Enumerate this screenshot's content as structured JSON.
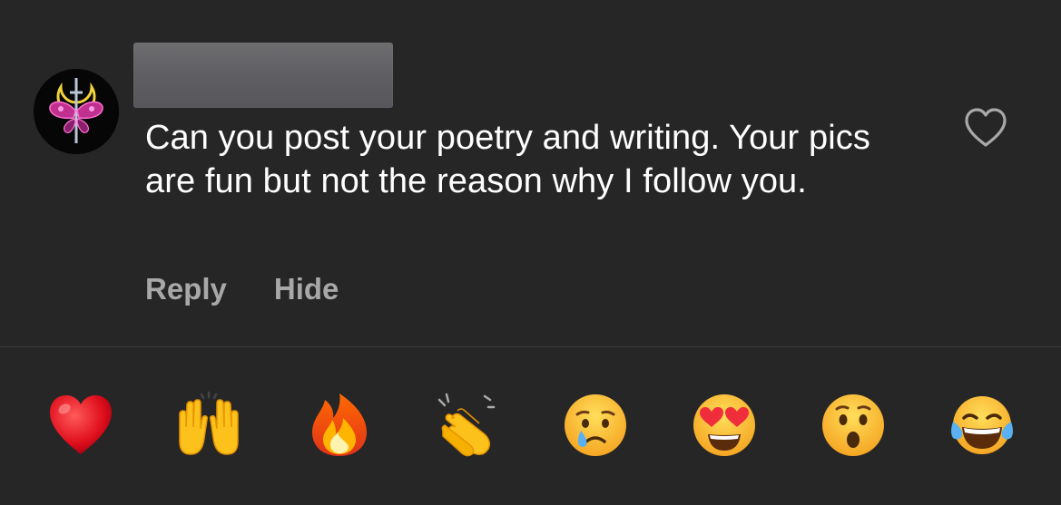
{
  "comment": {
    "username": "",
    "text": "Can you post your poetry and writing. Your pics are fun but not the reason why I follow you.",
    "actions": {
      "reply_label": "Reply",
      "hide_label": "Hide"
    },
    "like_icon": "heart-outline-icon"
  },
  "reactions": [
    {
      "icon": "red-heart-emoji"
    },
    {
      "icon": "raising-hands-emoji"
    },
    {
      "icon": "fire-emoji"
    },
    {
      "icon": "clapping-hands-emoji"
    },
    {
      "icon": "crying-face-emoji"
    },
    {
      "icon": "heart-eyes-emoji"
    },
    {
      "icon": "surprised-face-emoji"
    },
    {
      "icon": "tears-of-joy-emoji"
    }
  ],
  "colors": {
    "background": "#262626",
    "text": "#ffffff",
    "secondary_text": "#a8a8a8",
    "divider": "#3a3a3a"
  }
}
